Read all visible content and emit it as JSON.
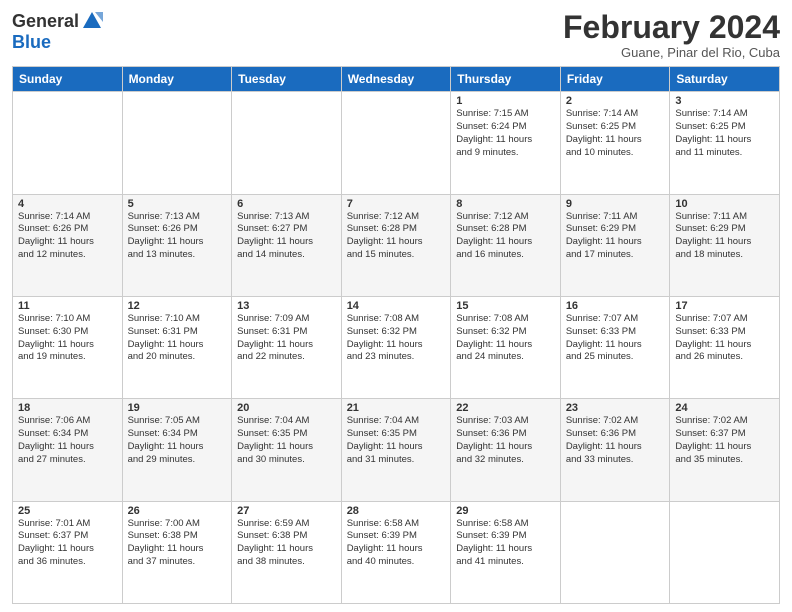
{
  "header": {
    "logo_general": "General",
    "logo_blue": "Blue",
    "title": "February 2024",
    "location": "Guane, Pinar del Rio, Cuba"
  },
  "days_of_week": [
    "Sunday",
    "Monday",
    "Tuesday",
    "Wednesday",
    "Thursday",
    "Friday",
    "Saturday"
  ],
  "weeks": [
    [
      {
        "day": "",
        "info": ""
      },
      {
        "day": "",
        "info": ""
      },
      {
        "day": "",
        "info": ""
      },
      {
        "day": "",
        "info": ""
      },
      {
        "day": "1",
        "info": "Sunrise: 7:15 AM\nSunset: 6:24 PM\nDaylight: 11 hours\nand 9 minutes."
      },
      {
        "day": "2",
        "info": "Sunrise: 7:14 AM\nSunset: 6:25 PM\nDaylight: 11 hours\nand 10 minutes."
      },
      {
        "day": "3",
        "info": "Sunrise: 7:14 AM\nSunset: 6:25 PM\nDaylight: 11 hours\nand 11 minutes."
      }
    ],
    [
      {
        "day": "4",
        "info": "Sunrise: 7:14 AM\nSunset: 6:26 PM\nDaylight: 11 hours\nand 12 minutes."
      },
      {
        "day": "5",
        "info": "Sunrise: 7:13 AM\nSunset: 6:26 PM\nDaylight: 11 hours\nand 13 minutes."
      },
      {
        "day": "6",
        "info": "Sunrise: 7:13 AM\nSunset: 6:27 PM\nDaylight: 11 hours\nand 14 minutes."
      },
      {
        "day": "7",
        "info": "Sunrise: 7:12 AM\nSunset: 6:28 PM\nDaylight: 11 hours\nand 15 minutes."
      },
      {
        "day": "8",
        "info": "Sunrise: 7:12 AM\nSunset: 6:28 PM\nDaylight: 11 hours\nand 16 minutes."
      },
      {
        "day": "9",
        "info": "Sunrise: 7:11 AM\nSunset: 6:29 PM\nDaylight: 11 hours\nand 17 minutes."
      },
      {
        "day": "10",
        "info": "Sunrise: 7:11 AM\nSunset: 6:29 PM\nDaylight: 11 hours\nand 18 minutes."
      }
    ],
    [
      {
        "day": "11",
        "info": "Sunrise: 7:10 AM\nSunset: 6:30 PM\nDaylight: 11 hours\nand 19 minutes."
      },
      {
        "day": "12",
        "info": "Sunrise: 7:10 AM\nSunset: 6:31 PM\nDaylight: 11 hours\nand 20 minutes."
      },
      {
        "day": "13",
        "info": "Sunrise: 7:09 AM\nSunset: 6:31 PM\nDaylight: 11 hours\nand 22 minutes."
      },
      {
        "day": "14",
        "info": "Sunrise: 7:08 AM\nSunset: 6:32 PM\nDaylight: 11 hours\nand 23 minutes."
      },
      {
        "day": "15",
        "info": "Sunrise: 7:08 AM\nSunset: 6:32 PM\nDaylight: 11 hours\nand 24 minutes."
      },
      {
        "day": "16",
        "info": "Sunrise: 7:07 AM\nSunset: 6:33 PM\nDaylight: 11 hours\nand 25 minutes."
      },
      {
        "day": "17",
        "info": "Sunrise: 7:07 AM\nSunset: 6:33 PM\nDaylight: 11 hours\nand 26 minutes."
      }
    ],
    [
      {
        "day": "18",
        "info": "Sunrise: 7:06 AM\nSunset: 6:34 PM\nDaylight: 11 hours\nand 27 minutes."
      },
      {
        "day": "19",
        "info": "Sunrise: 7:05 AM\nSunset: 6:34 PM\nDaylight: 11 hours\nand 29 minutes."
      },
      {
        "day": "20",
        "info": "Sunrise: 7:04 AM\nSunset: 6:35 PM\nDaylight: 11 hours\nand 30 minutes."
      },
      {
        "day": "21",
        "info": "Sunrise: 7:04 AM\nSunset: 6:35 PM\nDaylight: 11 hours\nand 31 minutes."
      },
      {
        "day": "22",
        "info": "Sunrise: 7:03 AM\nSunset: 6:36 PM\nDaylight: 11 hours\nand 32 minutes."
      },
      {
        "day": "23",
        "info": "Sunrise: 7:02 AM\nSunset: 6:36 PM\nDaylight: 11 hours\nand 33 minutes."
      },
      {
        "day": "24",
        "info": "Sunrise: 7:02 AM\nSunset: 6:37 PM\nDaylight: 11 hours\nand 35 minutes."
      }
    ],
    [
      {
        "day": "25",
        "info": "Sunrise: 7:01 AM\nSunset: 6:37 PM\nDaylight: 11 hours\nand 36 minutes."
      },
      {
        "day": "26",
        "info": "Sunrise: 7:00 AM\nSunset: 6:38 PM\nDaylight: 11 hours\nand 37 minutes."
      },
      {
        "day": "27",
        "info": "Sunrise: 6:59 AM\nSunset: 6:38 PM\nDaylight: 11 hours\nand 38 minutes."
      },
      {
        "day": "28",
        "info": "Sunrise: 6:58 AM\nSunset: 6:39 PM\nDaylight: 11 hours\nand 40 minutes."
      },
      {
        "day": "29",
        "info": "Sunrise: 6:58 AM\nSunset: 6:39 PM\nDaylight: 11 hours\nand 41 minutes."
      },
      {
        "day": "",
        "info": ""
      },
      {
        "day": "",
        "info": ""
      }
    ]
  ]
}
